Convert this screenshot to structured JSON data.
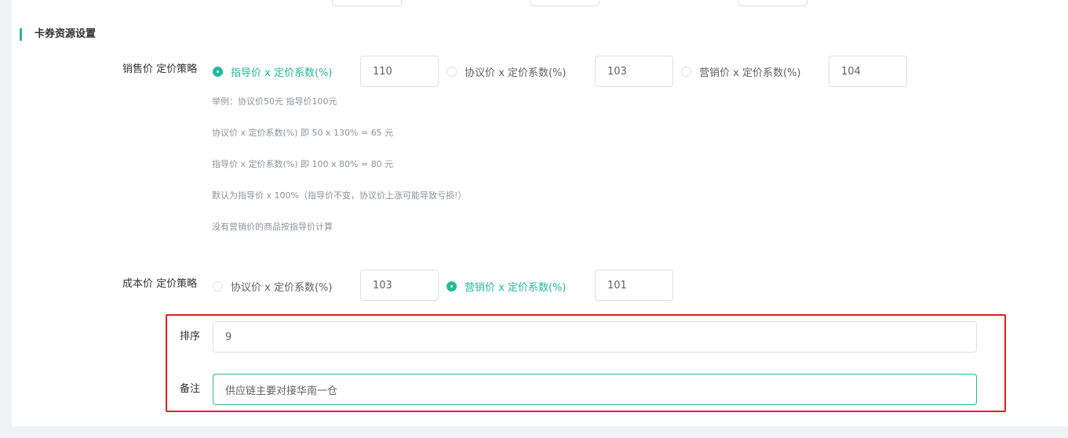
{
  "section": {
    "title": "卡券资源设置"
  },
  "sale_strategy": {
    "label": "销售价 定价策略",
    "options": [
      {
        "label": "指导价 x 定价系数(%)",
        "value": "110",
        "checked": true
      },
      {
        "label": "协议价 x 定价系数(%)",
        "value": "103",
        "checked": false
      },
      {
        "label": "营销价 x 定价系数(%)",
        "value": "104",
        "checked": false
      }
    ]
  },
  "hints": [
    "举例：协议价50元 指导价100元",
    "协议价 x 定价系数(%) 即 50 x 130% = 65 元",
    "指导价 x 定价系数(%) 即 100 x 80% = 80 元",
    "默认为指导价 x 100%（指导价不变，协议价上涨可能导致亏损!）",
    "没有营销价的商品按指导价计算"
  ],
  "cost_strategy": {
    "label": "成本价 定价策略",
    "options": [
      {
        "label": "协议价 x 定价系数(%)",
        "value": "103",
        "checked": false
      },
      {
        "label": "营销价 x 定价系数(%)",
        "value": "101",
        "checked": true
      }
    ]
  },
  "sort": {
    "label": "排序",
    "value": "9"
  },
  "remark": {
    "label": "备注",
    "value": "供应链主要对接华南一仓"
  },
  "colors": {
    "accent": "#26b99a",
    "highlight": "#e02020"
  }
}
